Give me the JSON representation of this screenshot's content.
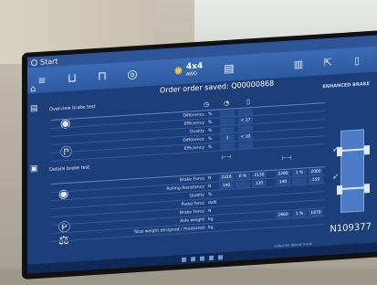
{
  "app": {
    "title": "Start"
  },
  "toolbar": {
    "mode_label": "4x4",
    "mode_sub": "AWD",
    "order_message": "Order order saved: Q00000868"
  },
  "overview": {
    "title": "Overview brake test",
    "rows": [
      {
        "label": "Difference",
        "unit": "%",
        "c1": "",
        "c2": ""
      },
      {
        "label": "Efficiency",
        "unit": "%",
        "c1": "",
        "c2": "< 17"
      },
      {
        "label": "Ovality",
        "unit": "%",
        "c1": "",
        "c2": ""
      },
      {
        "label": "Difference",
        "unit": "%",
        "c1": "1",
        "c2": "< 10"
      },
      {
        "label": "Efficiency",
        "unit": "%",
        "c1": "",
        "c2": ""
      }
    ]
  },
  "detail": {
    "title": "Details brake test",
    "rows": [
      {
        "label": "Brake Force",
        "unit": "N",
        "v": [
          "2220",
          "6 %",
          "2130",
          "2280",
          "1 %",
          "2060"
        ]
      },
      {
        "label": "Rolling Resistance",
        "unit": "N",
        "v": [
          "140",
          "",
          "130",
          "140",
          "",
          "150"
        ]
      },
      {
        "label": "Quality",
        "unit": "%",
        "v": [
          "",
          "",
          "",
          "",
          "",
          ""
        ]
      },
      {
        "label": "Pedal force",
        "unit": "daN",
        "v": [
          "",
          "",
          "",
          "",
          "",
          ""
        ]
      },
      {
        "label": "Brake Force",
        "unit": "N",
        "v": [
          "",
          "",
          "",
          "",
          "",
          ""
        ]
      },
      {
        "label": "Axle weight",
        "unit": "kg",
        "v": [
          "",
          "",
          "",
          "1660",
          "1 %",
          "1670"
        ]
      },
      {
        "label": "Total weight designed / measured",
        "unit": "kg",
        "v": [
          "",
          "",
          "",
          "",
          "",
          ""
        ]
      }
    ]
  },
  "brand_text": "ENHANCED BRAKE",
  "registration": "N109377",
  "footnote": "ssified for Reteat mode",
  "colors": {
    "screen_bg": "#1c3f7a",
    "toolbar": "#3b6cb6",
    "accent": "#f2c23b",
    "check": "#5cc0f2"
  }
}
